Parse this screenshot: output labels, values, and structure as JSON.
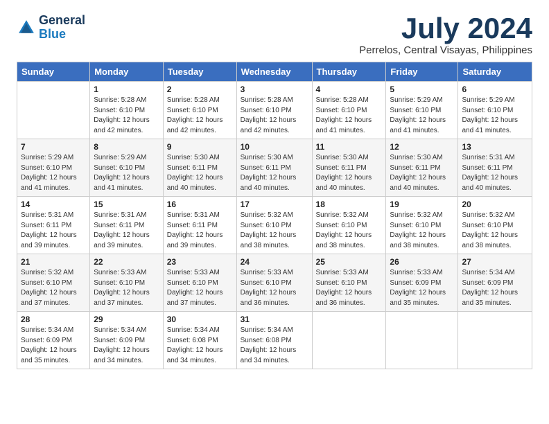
{
  "logo": {
    "text_general": "General",
    "text_blue": "Blue"
  },
  "title": "July 2024",
  "location": "Perrelos, Central Visayas, Philippines",
  "weekdays": [
    "Sunday",
    "Monday",
    "Tuesday",
    "Wednesday",
    "Thursday",
    "Friday",
    "Saturday"
  ],
  "weeks": [
    [
      {
        "day": "",
        "sunrise": "",
        "sunset": "",
        "daylight": ""
      },
      {
        "day": "1",
        "sunrise": "Sunrise: 5:28 AM",
        "sunset": "Sunset: 6:10 PM",
        "daylight": "Daylight: 12 hours and 42 minutes."
      },
      {
        "day": "2",
        "sunrise": "Sunrise: 5:28 AM",
        "sunset": "Sunset: 6:10 PM",
        "daylight": "Daylight: 12 hours and 42 minutes."
      },
      {
        "day": "3",
        "sunrise": "Sunrise: 5:28 AM",
        "sunset": "Sunset: 6:10 PM",
        "daylight": "Daylight: 12 hours and 42 minutes."
      },
      {
        "day": "4",
        "sunrise": "Sunrise: 5:28 AM",
        "sunset": "Sunset: 6:10 PM",
        "daylight": "Daylight: 12 hours and 41 minutes."
      },
      {
        "day": "5",
        "sunrise": "Sunrise: 5:29 AM",
        "sunset": "Sunset: 6:10 PM",
        "daylight": "Daylight: 12 hours and 41 minutes."
      },
      {
        "day": "6",
        "sunrise": "Sunrise: 5:29 AM",
        "sunset": "Sunset: 6:10 PM",
        "daylight": "Daylight: 12 hours and 41 minutes."
      }
    ],
    [
      {
        "day": "7",
        "sunrise": "Sunrise: 5:29 AM",
        "sunset": "Sunset: 6:10 PM",
        "daylight": "Daylight: 12 hours and 41 minutes."
      },
      {
        "day": "8",
        "sunrise": "Sunrise: 5:29 AM",
        "sunset": "Sunset: 6:10 PM",
        "daylight": "Daylight: 12 hours and 41 minutes."
      },
      {
        "day": "9",
        "sunrise": "Sunrise: 5:30 AM",
        "sunset": "Sunset: 6:11 PM",
        "daylight": "Daylight: 12 hours and 40 minutes."
      },
      {
        "day": "10",
        "sunrise": "Sunrise: 5:30 AM",
        "sunset": "Sunset: 6:11 PM",
        "daylight": "Daylight: 12 hours and 40 minutes."
      },
      {
        "day": "11",
        "sunrise": "Sunrise: 5:30 AM",
        "sunset": "Sunset: 6:11 PM",
        "daylight": "Daylight: 12 hours and 40 minutes."
      },
      {
        "day": "12",
        "sunrise": "Sunrise: 5:30 AM",
        "sunset": "Sunset: 6:11 PM",
        "daylight": "Daylight: 12 hours and 40 minutes."
      },
      {
        "day": "13",
        "sunrise": "Sunrise: 5:31 AM",
        "sunset": "Sunset: 6:11 PM",
        "daylight": "Daylight: 12 hours and 40 minutes."
      }
    ],
    [
      {
        "day": "14",
        "sunrise": "Sunrise: 5:31 AM",
        "sunset": "Sunset: 6:11 PM",
        "daylight": "Daylight: 12 hours and 39 minutes."
      },
      {
        "day": "15",
        "sunrise": "Sunrise: 5:31 AM",
        "sunset": "Sunset: 6:11 PM",
        "daylight": "Daylight: 12 hours and 39 minutes."
      },
      {
        "day": "16",
        "sunrise": "Sunrise: 5:31 AM",
        "sunset": "Sunset: 6:11 PM",
        "daylight": "Daylight: 12 hours and 39 minutes."
      },
      {
        "day": "17",
        "sunrise": "Sunrise: 5:32 AM",
        "sunset": "Sunset: 6:10 PM",
        "daylight": "Daylight: 12 hours and 38 minutes."
      },
      {
        "day": "18",
        "sunrise": "Sunrise: 5:32 AM",
        "sunset": "Sunset: 6:10 PM",
        "daylight": "Daylight: 12 hours and 38 minutes."
      },
      {
        "day": "19",
        "sunrise": "Sunrise: 5:32 AM",
        "sunset": "Sunset: 6:10 PM",
        "daylight": "Daylight: 12 hours and 38 minutes."
      },
      {
        "day": "20",
        "sunrise": "Sunrise: 5:32 AM",
        "sunset": "Sunset: 6:10 PM",
        "daylight": "Daylight: 12 hours and 38 minutes."
      }
    ],
    [
      {
        "day": "21",
        "sunrise": "Sunrise: 5:32 AM",
        "sunset": "Sunset: 6:10 PM",
        "daylight": "Daylight: 12 hours and 37 minutes."
      },
      {
        "day": "22",
        "sunrise": "Sunrise: 5:33 AM",
        "sunset": "Sunset: 6:10 PM",
        "daylight": "Daylight: 12 hours and 37 minutes."
      },
      {
        "day": "23",
        "sunrise": "Sunrise: 5:33 AM",
        "sunset": "Sunset: 6:10 PM",
        "daylight": "Daylight: 12 hours and 37 minutes."
      },
      {
        "day": "24",
        "sunrise": "Sunrise: 5:33 AM",
        "sunset": "Sunset: 6:10 PM",
        "daylight": "Daylight: 12 hours and 36 minutes."
      },
      {
        "day": "25",
        "sunrise": "Sunrise: 5:33 AM",
        "sunset": "Sunset: 6:10 PM",
        "daylight": "Daylight: 12 hours and 36 minutes."
      },
      {
        "day": "26",
        "sunrise": "Sunrise: 5:33 AM",
        "sunset": "Sunset: 6:09 PM",
        "daylight": "Daylight: 12 hours and 35 minutes."
      },
      {
        "day": "27",
        "sunrise": "Sunrise: 5:34 AM",
        "sunset": "Sunset: 6:09 PM",
        "daylight": "Daylight: 12 hours and 35 minutes."
      }
    ],
    [
      {
        "day": "28",
        "sunrise": "Sunrise: 5:34 AM",
        "sunset": "Sunset: 6:09 PM",
        "daylight": "Daylight: 12 hours and 35 minutes."
      },
      {
        "day": "29",
        "sunrise": "Sunrise: 5:34 AM",
        "sunset": "Sunset: 6:09 PM",
        "daylight": "Daylight: 12 hours and 34 minutes."
      },
      {
        "day": "30",
        "sunrise": "Sunrise: 5:34 AM",
        "sunset": "Sunset: 6:08 PM",
        "daylight": "Daylight: 12 hours and 34 minutes."
      },
      {
        "day": "31",
        "sunrise": "Sunrise: 5:34 AM",
        "sunset": "Sunset: 6:08 PM",
        "daylight": "Daylight: 12 hours and 34 minutes."
      },
      {
        "day": "",
        "sunrise": "",
        "sunset": "",
        "daylight": ""
      },
      {
        "day": "",
        "sunrise": "",
        "sunset": "",
        "daylight": ""
      },
      {
        "day": "",
        "sunrise": "",
        "sunset": "",
        "daylight": ""
      }
    ]
  ]
}
